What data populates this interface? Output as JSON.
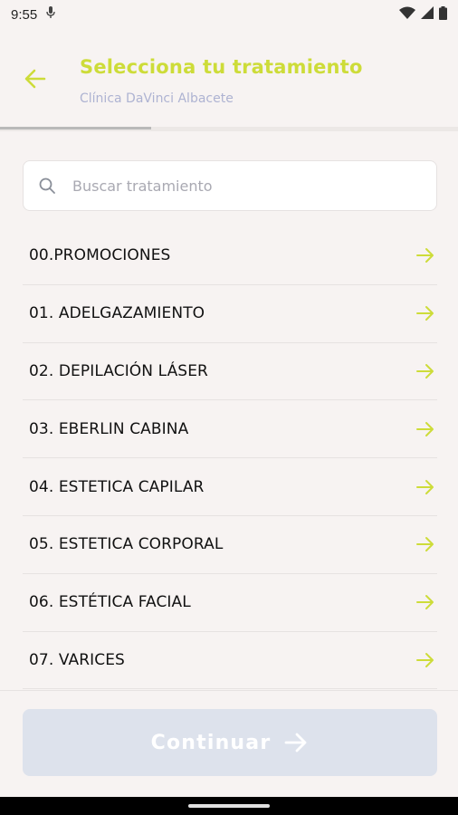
{
  "status_bar": {
    "time": "9:55",
    "icons": [
      "mic-icon",
      "wifi-icon",
      "signal-icon",
      "battery-icon"
    ]
  },
  "header": {
    "back_icon": "arrow-left-icon",
    "title": "Selecciona tu tratamiento",
    "subtitle": "Clínica DaVinci Albacete"
  },
  "progress": {
    "fraction": 0.33
  },
  "search": {
    "placeholder": "Buscar tratamiento",
    "value": "",
    "icon": "search-icon"
  },
  "treatments": [
    {
      "label": "00.PROMOCIONES"
    },
    {
      "label": "01. ADELGAZAMIENTO"
    },
    {
      "label": "02. DEPILACIÓN LÁSER"
    },
    {
      "label": "03. EBERLIN CABINA"
    },
    {
      "label": "04. ESTETICA CAPILAR"
    },
    {
      "label": "05. ESTETICA CORPORAL"
    },
    {
      "label": "06. ESTÉTICA FACIAL"
    },
    {
      "label": "07. VARICES"
    }
  ],
  "footer": {
    "continue_label": "Continuar",
    "continue_enabled": false
  },
  "colors": {
    "accent": "#cddc39",
    "subtitle": "#aeb3d2",
    "button_disabled": "#dde2ec",
    "background": "#f7f3f2"
  }
}
